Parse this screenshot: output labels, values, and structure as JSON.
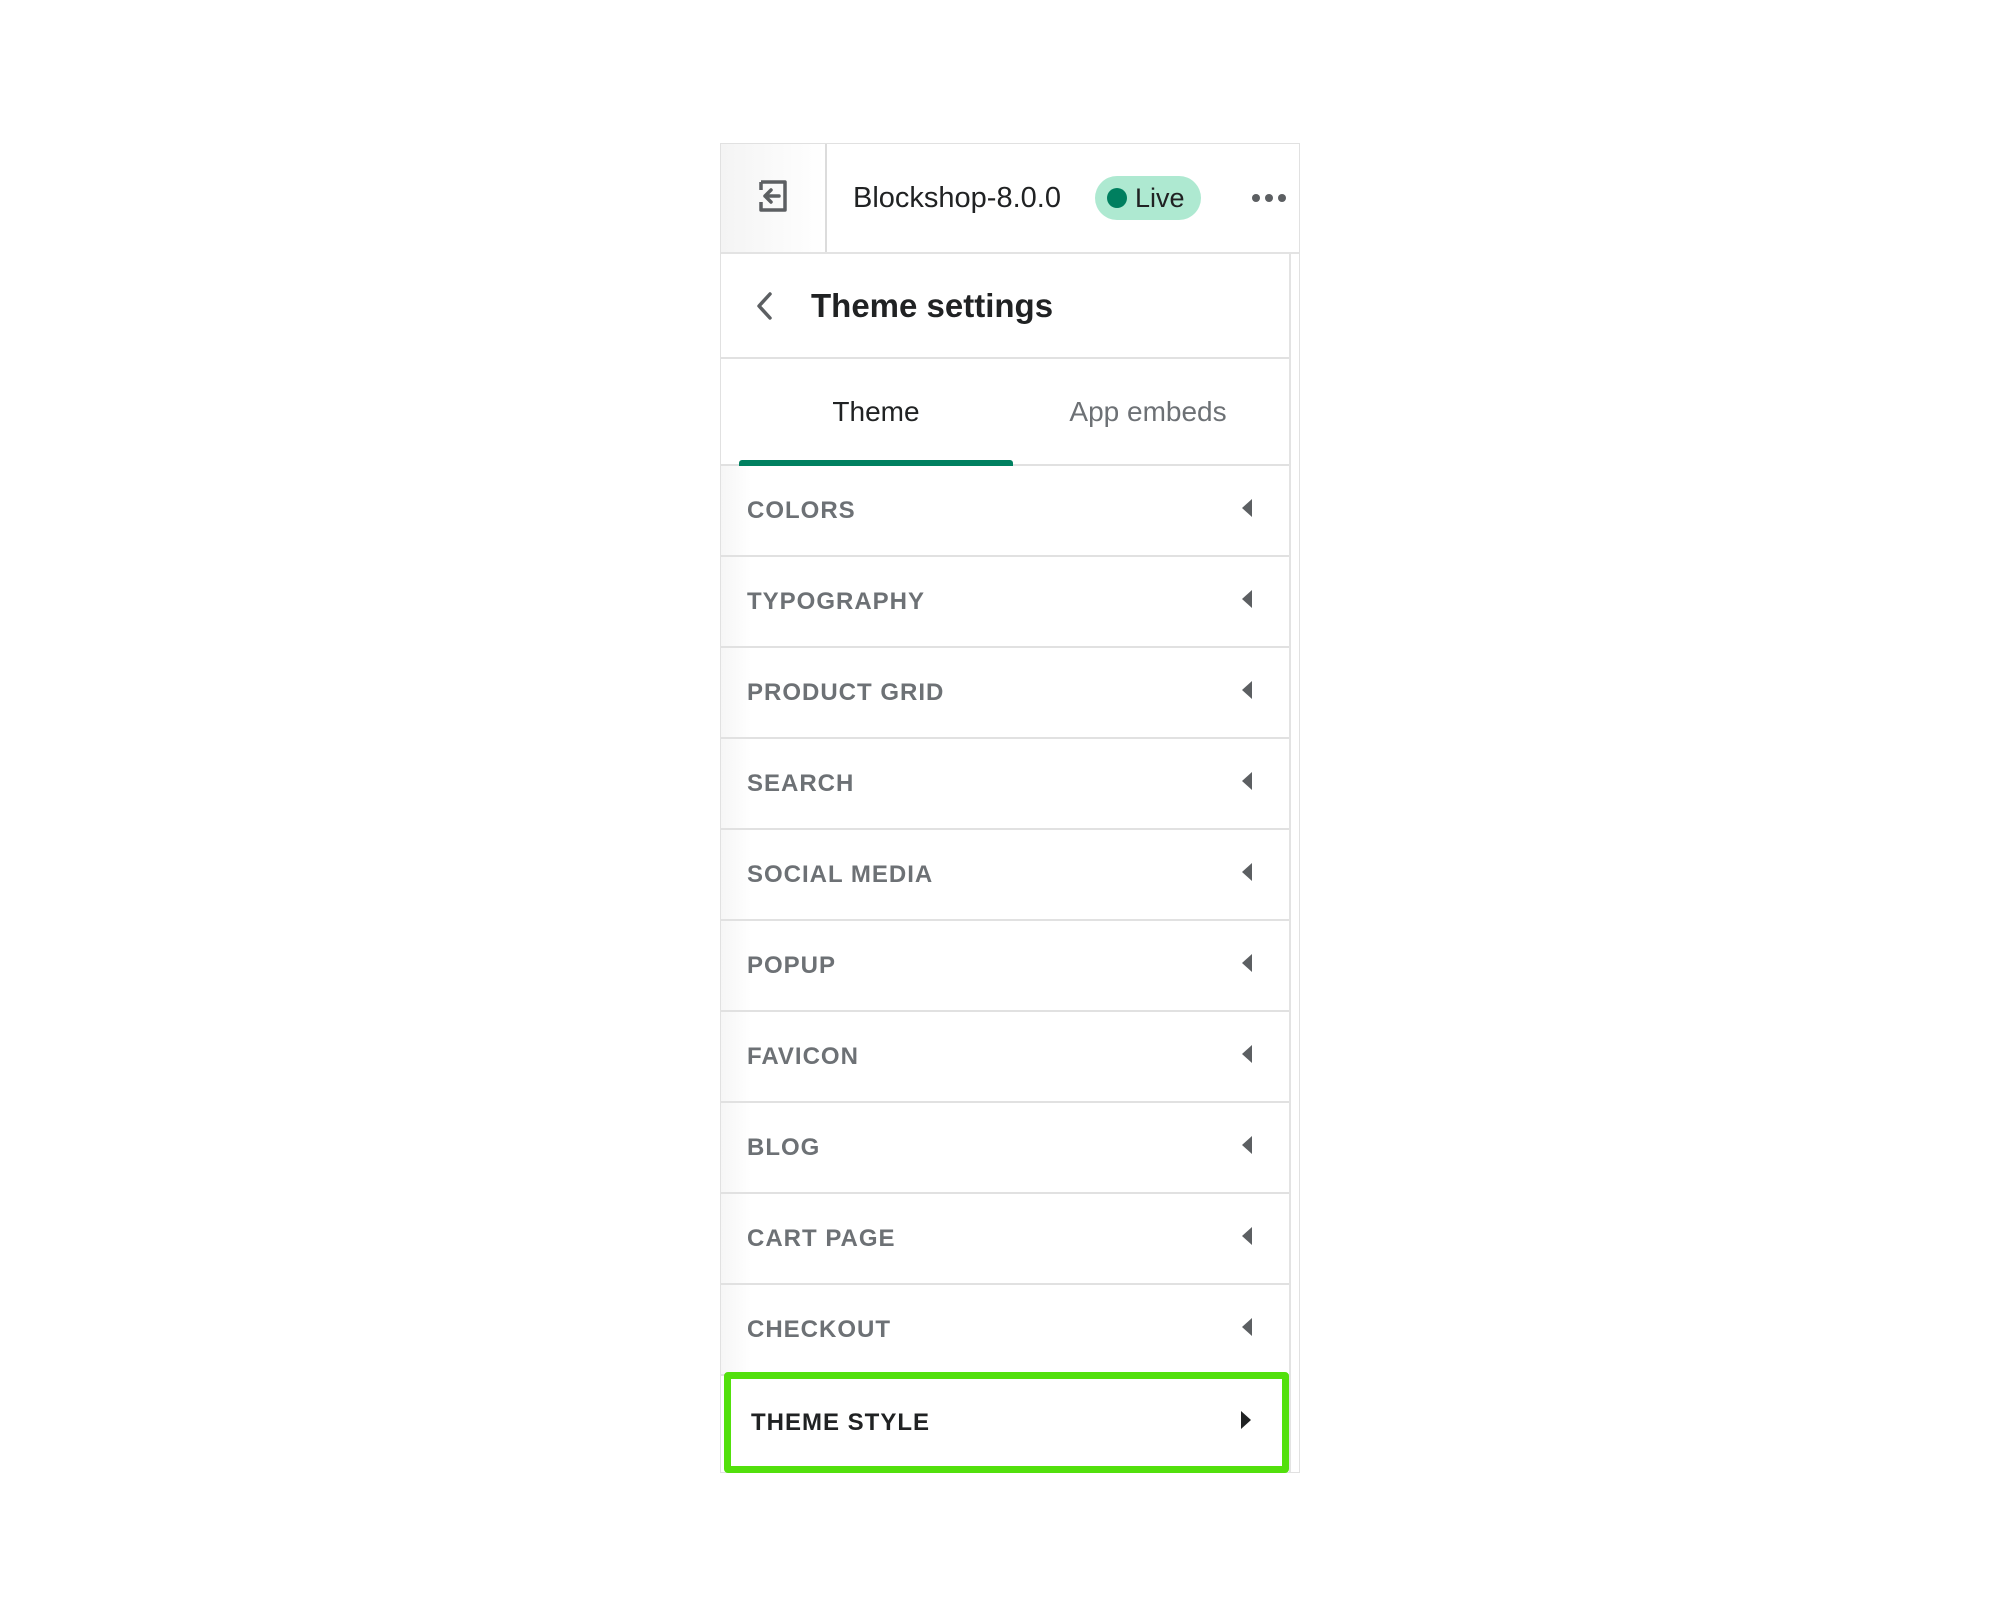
{
  "header": {
    "exit_icon": "exit-arrow-icon",
    "theme_name": "Blockshop-8.0.0",
    "status_badge": "Live",
    "status_color": "#007f5f",
    "badge_bg": "#aee9d1",
    "more_icon": "ellipsis-icon"
  },
  "title_bar": {
    "back_icon": "chevron-left-icon",
    "title": "Theme settings"
  },
  "tabs": [
    {
      "label": "Theme",
      "active": true
    },
    {
      "label": "App embeds",
      "active": false
    }
  ],
  "accent_color": "#008060",
  "highlight_color": "#52e00c",
  "settings_items": [
    {
      "label": "COLORS",
      "expanded": false
    },
    {
      "label": "TYPOGRAPHY",
      "expanded": false
    },
    {
      "label": "PRODUCT GRID",
      "expanded": false
    },
    {
      "label": "SEARCH",
      "expanded": false
    },
    {
      "label": "SOCIAL MEDIA",
      "expanded": false
    },
    {
      "label": "POPUP",
      "expanded": false
    },
    {
      "label": "FAVICON",
      "expanded": false
    },
    {
      "label": "BLOG",
      "expanded": false
    },
    {
      "label": "CART PAGE",
      "expanded": false
    },
    {
      "label": "CHECKOUT",
      "expanded": false
    },
    {
      "label": "THEME STYLE",
      "expanded": false,
      "highlighted": true
    }
  ]
}
